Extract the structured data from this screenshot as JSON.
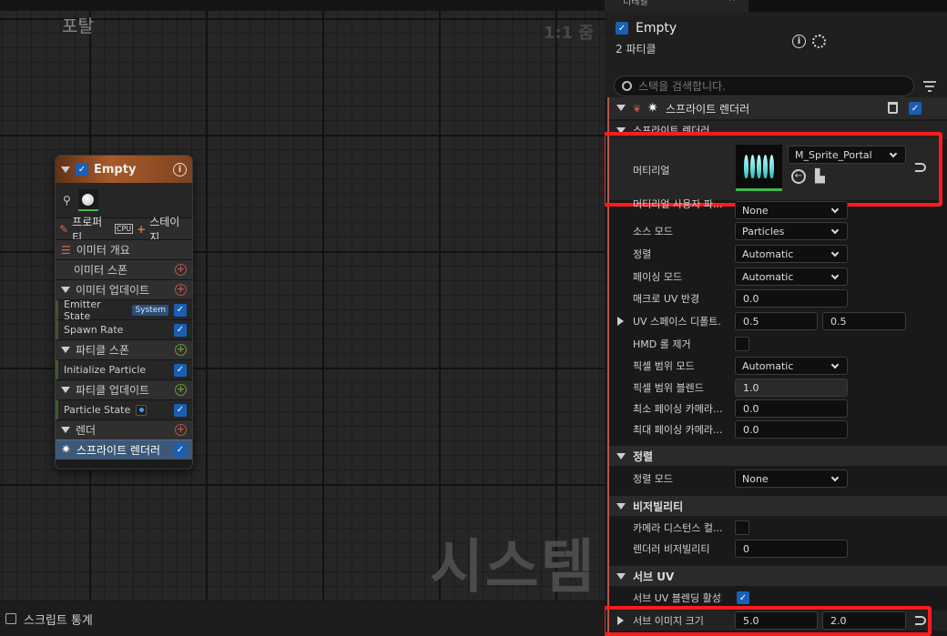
{
  "graph": {
    "title": "포탈",
    "zoom": "1:1 줌",
    "watermark": "시스템",
    "stats_label": "스크립트 통계"
  },
  "node": {
    "title": "Empty",
    "tab_properties": "프로퍼티",
    "tab_cpu": "CPU",
    "tab_stage": "스테이지",
    "rows": {
      "emitter_summary": "이미터 개요",
      "emitter_spawn": "이미터 스폰",
      "emitter_update": "이미터 업데이트",
      "emitter_state": "Emitter State",
      "emitter_state_badge": "System",
      "spawn_rate": "Spawn Rate",
      "particle_spawn": "파티클 스폰",
      "initialize_particle": "Initialize Particle",
      "particle_update": "파티클 업데이트",
      "particle_state": "Particle State",
      "render": "렌더",
      "sprite_renderer": "스프라이트 렌더러"
    }
  },
  "details": {
    "tab_label": "디테일",
    "title": "Empty",
    "particle_count": "2 파티클",
    "search_placeholder": "스택을 검색합니다.",
    "module_title": "스프라이트 렌더러",
    "sub_section_clipped": "스프라이트 렌더러",
    "material_label": "머티리얼",
    "material_value": "M_Sprite_Portal",
    "properties": [
      {
        "label": "머티리얼 사용자 파...",
        "value": "None"
      },
      {
        "label": "소스 모드",
        "value": "Particles"
      },
      {
        "label": "정렬",
        "value": "Automatic"
      },
      {
        "label": "페이싱 모드",
        "value": "Automatic"
      },
      {
        "label": "매크로 UV 반경",
        "value": "0.0"
      },
      {
        "label": "UV 스페이스 디폴트...",
        "value_x": "0.5",
        "value_y": "0.5"
      },
      {
        "label": "HMD 롤 제거"
      },
      {
        "label": "픽셀 범위 모드",
        "value": "Automatic"
      },
      {
        "label": "픽셀 범위 블렌드",
        "value": "1.0"
      },
      {
        "label": "최소 페이싱 카메라...",
        "value": "0.0"
      },
      {
        "label": "최대 페이싱 카메라...",
        "value": "0.0"
      }
    ],
    "sort_section": "정렬",
    "sort_mode_label": "정렬 모드",
    "sort_mode_value": "None",
    "visibility_section": "비저빌리티",
    "camera_distance_label": "카메라 디스턴스 컬...",
    "renderer_visibility_label": "렌더러 비저빌리티",
    "renderer_visibility_value": "0",
    "subuv_section": "서브 UV",
    "subuv_blend_label": "서브 UV 블렌딩 활성화",
    "subimage_size_label": "서브 이미지 크기",
    "subimage_x": "5.0",
    "subimage_y": "2.0"
  },
  "colors": {
    "highlight_box": "#ff1c1c",
    "checkbox_blue": "#1a5fb4",
    "node_header": "#a85a2a"
  }
}
